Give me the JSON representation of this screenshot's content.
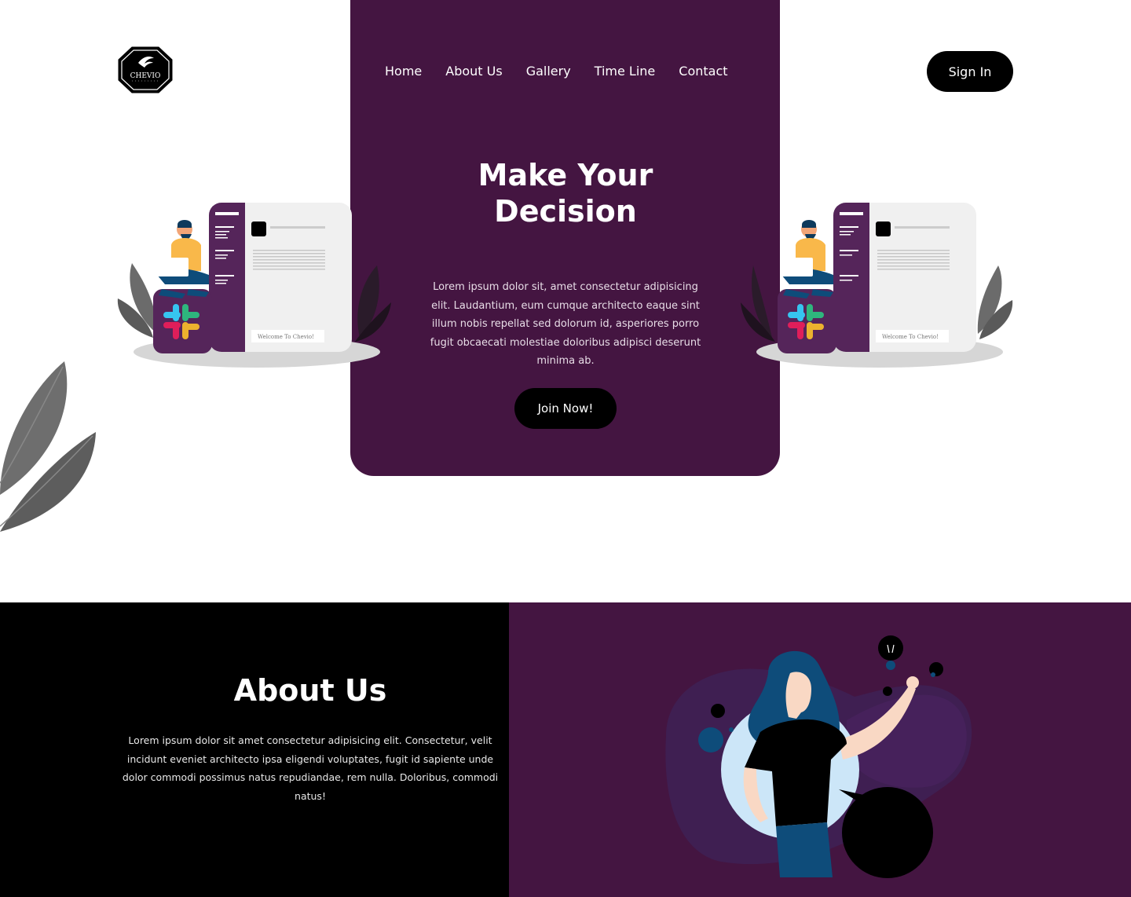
{
  "brand": {
    "logo_text": "CHEVIO",
    "logo_icon": "bird-wing-icon"
  },
  "nav": {
    "items": [
      {
        "label": "Home"
      },
      {
        "label": "About Us"
      },
      {
        "label": "Gallery"
      },
      {
        "label": "Time Line"
      },
      {
        "label": "Contact"
      }
    ]
  },
  "header": {
    "signin_label": "Sign In"
  },
  "hero": {
    "title_line1": "Make Your",
    "title_line2": "Decision",
    "body": "Lorem ipsum dolor sit, amet consectetur adipisicing elit. Laudantium, eum cumque architecto eaque sint illum nobis repellat sed dolorum id, asperiores porro fugit obcaecati molestiae doloribus adipisci deserunt minima ab.",
    "cta_label": "Join Now!",
    "illustration_caption": "Welcome To Chevio!"
  },
  "about": {
    "title": "About Us",
    "body": "Lorem ipsum dolor sit amet consectetur adipisicing elit. Consectetur, velit incidunt eveniet architecto ipsa eligendi voluptates, fugit id sapiente unde dolor commodi possimus natus repudiandae, rem nulla. Doloribus, commodi natus!"
  },
  "colors": {
    "brand_purple": "#441541",
    "black": "#000000",
    "white": "#ffffff",
    "accent_yellow": "#f9b84a",
    "accent_blue": "#0e4c7a",
    "light_blue": "#cce6f8"
  }
}
